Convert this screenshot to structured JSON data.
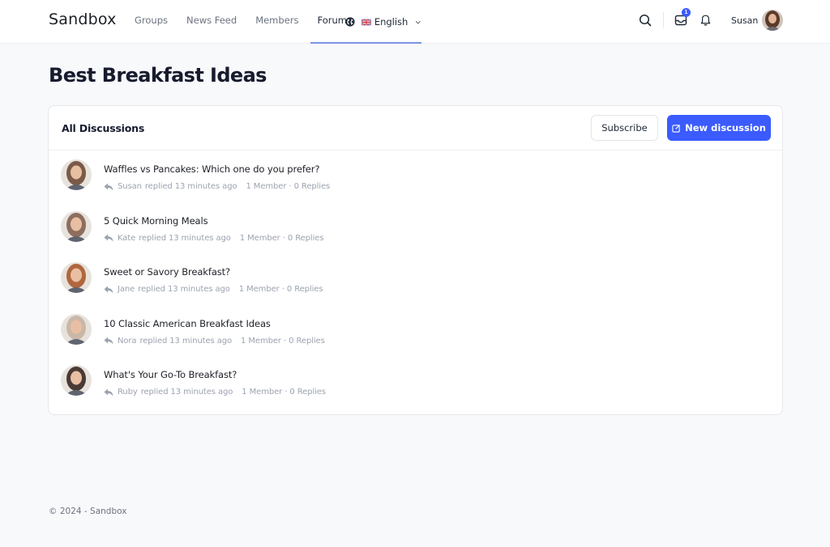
{
  "app": {
    "brand": "Sandbox"
  },
  "nav": {
    "items": [
      {
        "label": "Groups",
        "active": false
      },
      {
        "label": "News Feed",
        "active": false
      },
      {
        "label": "Members",
        "active": false
      },
      {
        "label": "Forums",
        "active": true
      }
    ],
    "language": {
      "label": "English",
      "icon": "globe-icon",
      "flag": "uk-flag-icon"
    }
  },
  "toolbar": {
    "search_icon": "search-icon",
    "inbox_icon": "inbox-icon",
    "inbox_badge": "1",
    "bell_icon": "bell-icon",
    "user_name": "Susan"
  },
  "page": {
    "title": "Best Breakfast Ideas"
  },
  "card": {
    "title": "All Discussions",
    "subscribe_label": "Subscribe",
    "new_discussion_label": "New discussion",
    "accent_color": "#3b5bfd"
  },
  "discussions": [
    {
      "title": "Waffles vs Pancakes: Which one do you prefer?",
      "user": "Susan",
      "action": "replied 13 minutes ago",
      "stats": "1 Member · 0 Replies",
      "avatar_color": "#7a5a48"
    },
    {
      "title": "5 Quick Morning Meals",
      "user": "Kate",
      "action": "replied 13 minutes ago",
      "stats": "1 Member · 0 Replies",
      "avatar_color": "#8d6e5e"
    },
    {
      "title": "Sweet or Savory Breakfast?",
      "user": "Jane",
      "action": "replied 13 minutes ago",
      "stats": "1 Member · 0 Replies",
      "avatar_color": "#b0673e"
    },
    {
      "title": "10 Classic American Breakfast Ideas",
      "user": "Nora",
      "action": "replied 13 minutes ago",
      "stats": "1 Member · 0 Replies",
      "avatar_color": "#c9b8a8"
    },
    {
      "title": "What's Your Go-To Breakfast?",
      "user": "Ruby",
      "action": "replied 13 minutes ago",
      "stats": "1 Member · 0 Replies",
      "avatar_color": "#4a3a36"
    }
  ],
  "footer": {
    "text": "© 2024 - Sandbox"
  }
}
